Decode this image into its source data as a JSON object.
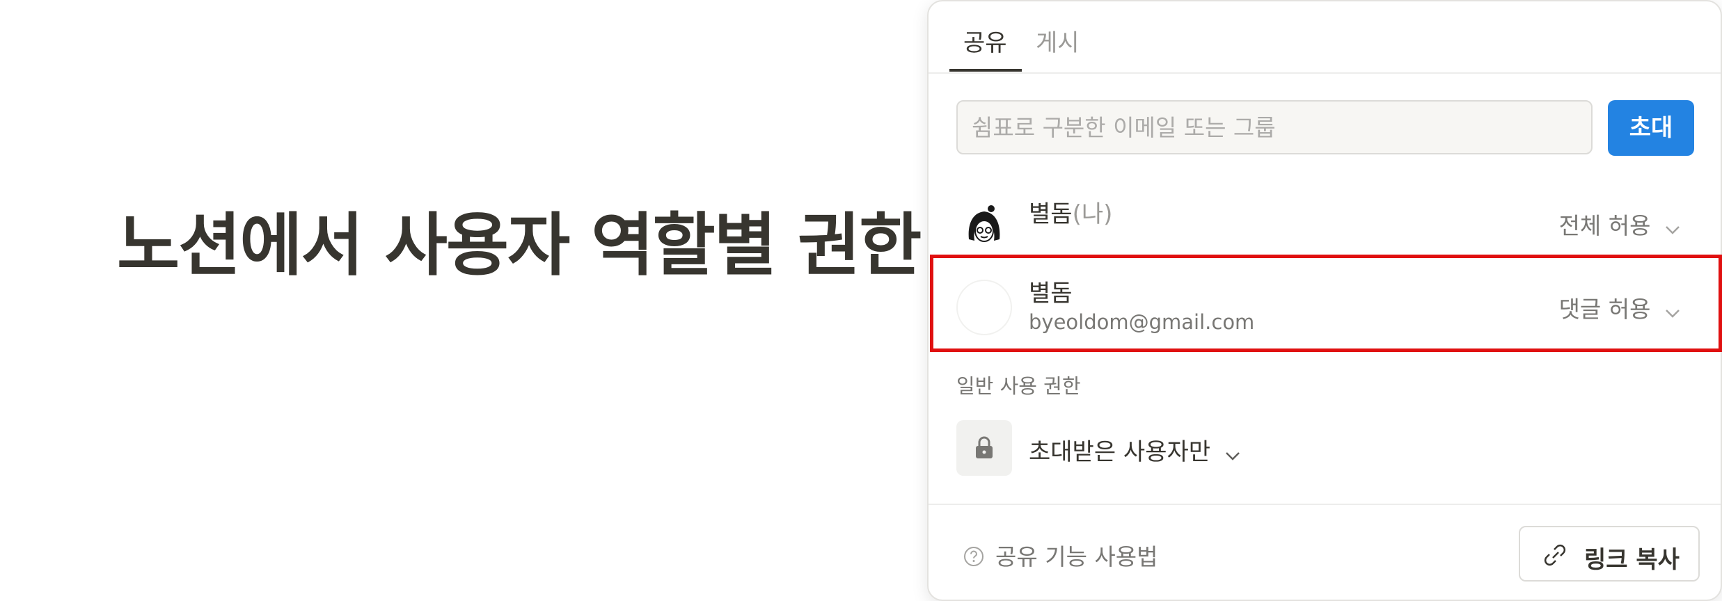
{
  "page": {
    "title": "노션에서 사용자 역할별 권한"
  },
  "share_popup": {
    "tabs": [
      {
        "label": "공유",
        "active": true
      },
      {
        "label": "게시",
        "active": false
      }
    ],
    "invite": {
      "placeholder": "쉼표로 구분한 이메일 또는 그룹",
      "button_label": "초대"
    },
    "members": [
      {
        "name": "별돔",
        "suffix": "(나)",
        "email": "",
        "permission": "전체 허용",
        "avatar": "illustrated-avatar-icon"
      },
      {
        "name": "별돔",
        "suffix": "",
        "email": "byeoldom@gmail.com",
        "permission": "댓글 허용",
        "avatar": "blank-avatar",
        "highlighted": true
      }
    ],
    "general_access": {
      "section_label": "일반 사용 권한",
      "value": "초대받은 사용자만",
      "icon": "lock-icon"
    },
    "footer": {
      "help_label": "공유 기능 사용법",
      "copy_link_label": "링크 복사"
    }
  },
  "colors": {
    "accent": "#2383e2",
    "highlight": "#e01010",
    "text": "#37352f",
    "muted": "#787774"
  }
}
